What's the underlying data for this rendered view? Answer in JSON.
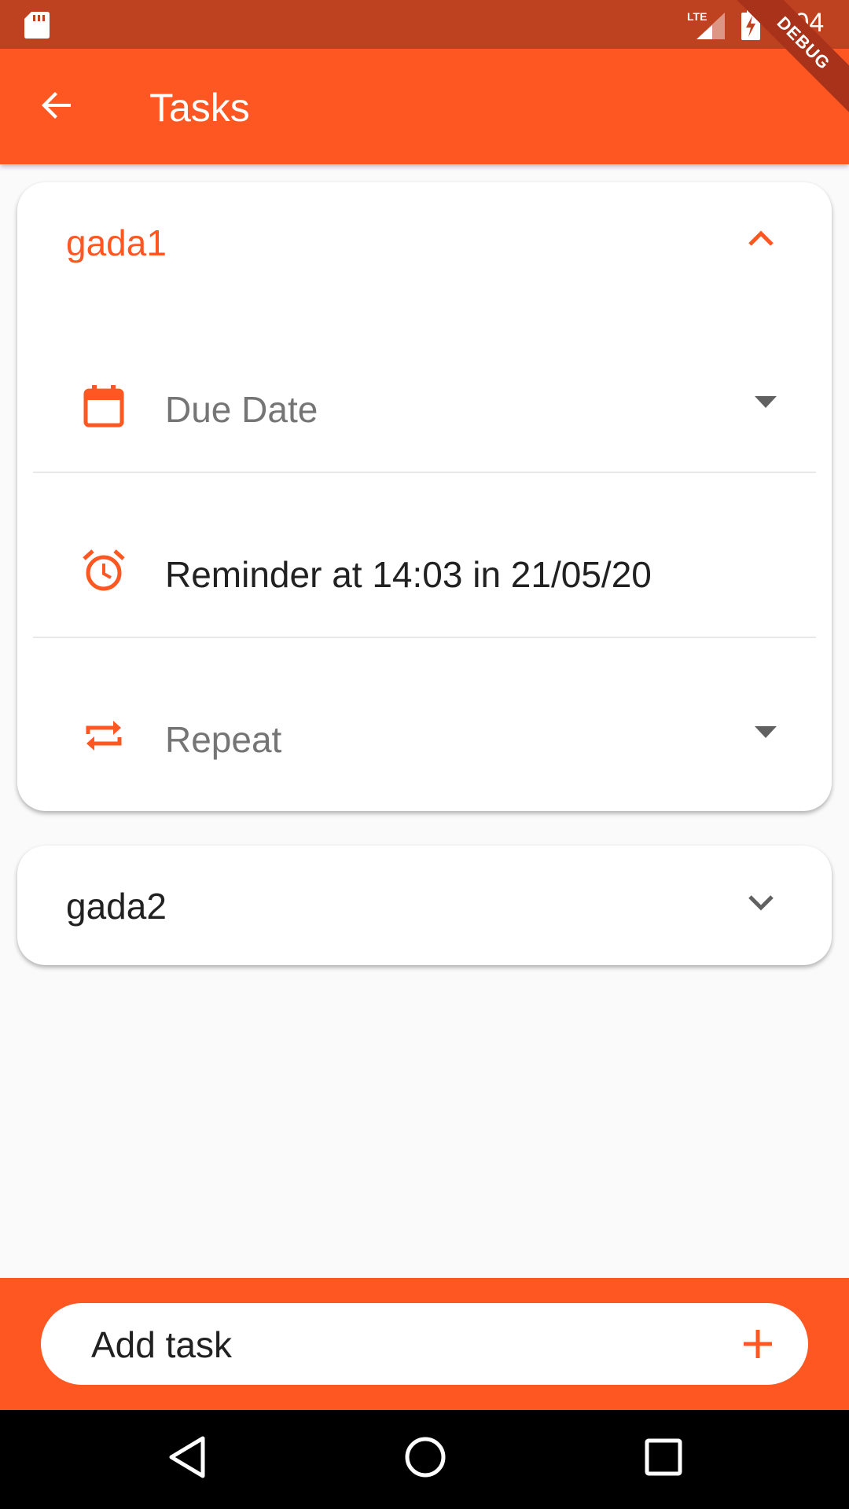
{
  "status_bar": {
    "time": "1:04",
    "network": "LTE",
    "icons": [
      "sd-card-icon",
      "signal-icon",
      "battery-charging-icon"
    ]
  },
  "debug_banner": "DEBUG",
  "app_bar": {
    "title": "Tasks",
    "back_icon": "arrow-back-icon"
  },
  "tasks": [
    {
      "title": "gada1",
      "expanded": true,
      "rows": [
        {
          "icon": "calendar-icon",
          "label": "Due Date",
          "dropdown": true
        },
        {
          "icon": "alarm-icon",
          "label": "Reminder at 14:03 in 21/05/20",
          "dropdown": false
        },
        {
          "icon": "repeat-icon",
          "label": "Repeat",
          "dropdown": true
        }
      ]
    },
    {
      "title": "gada2",
      "expanded": false
    }
  ],
  "add_task": {
    "placeholder": "Add task",
    "icon": "plus-icon"
  },
  "colors": {
    "accent": "#ff5722",
    "status_bar": "#bf4220",
    "muted_text": "#757575",
    "dark_text": "#212121"
  }
}
